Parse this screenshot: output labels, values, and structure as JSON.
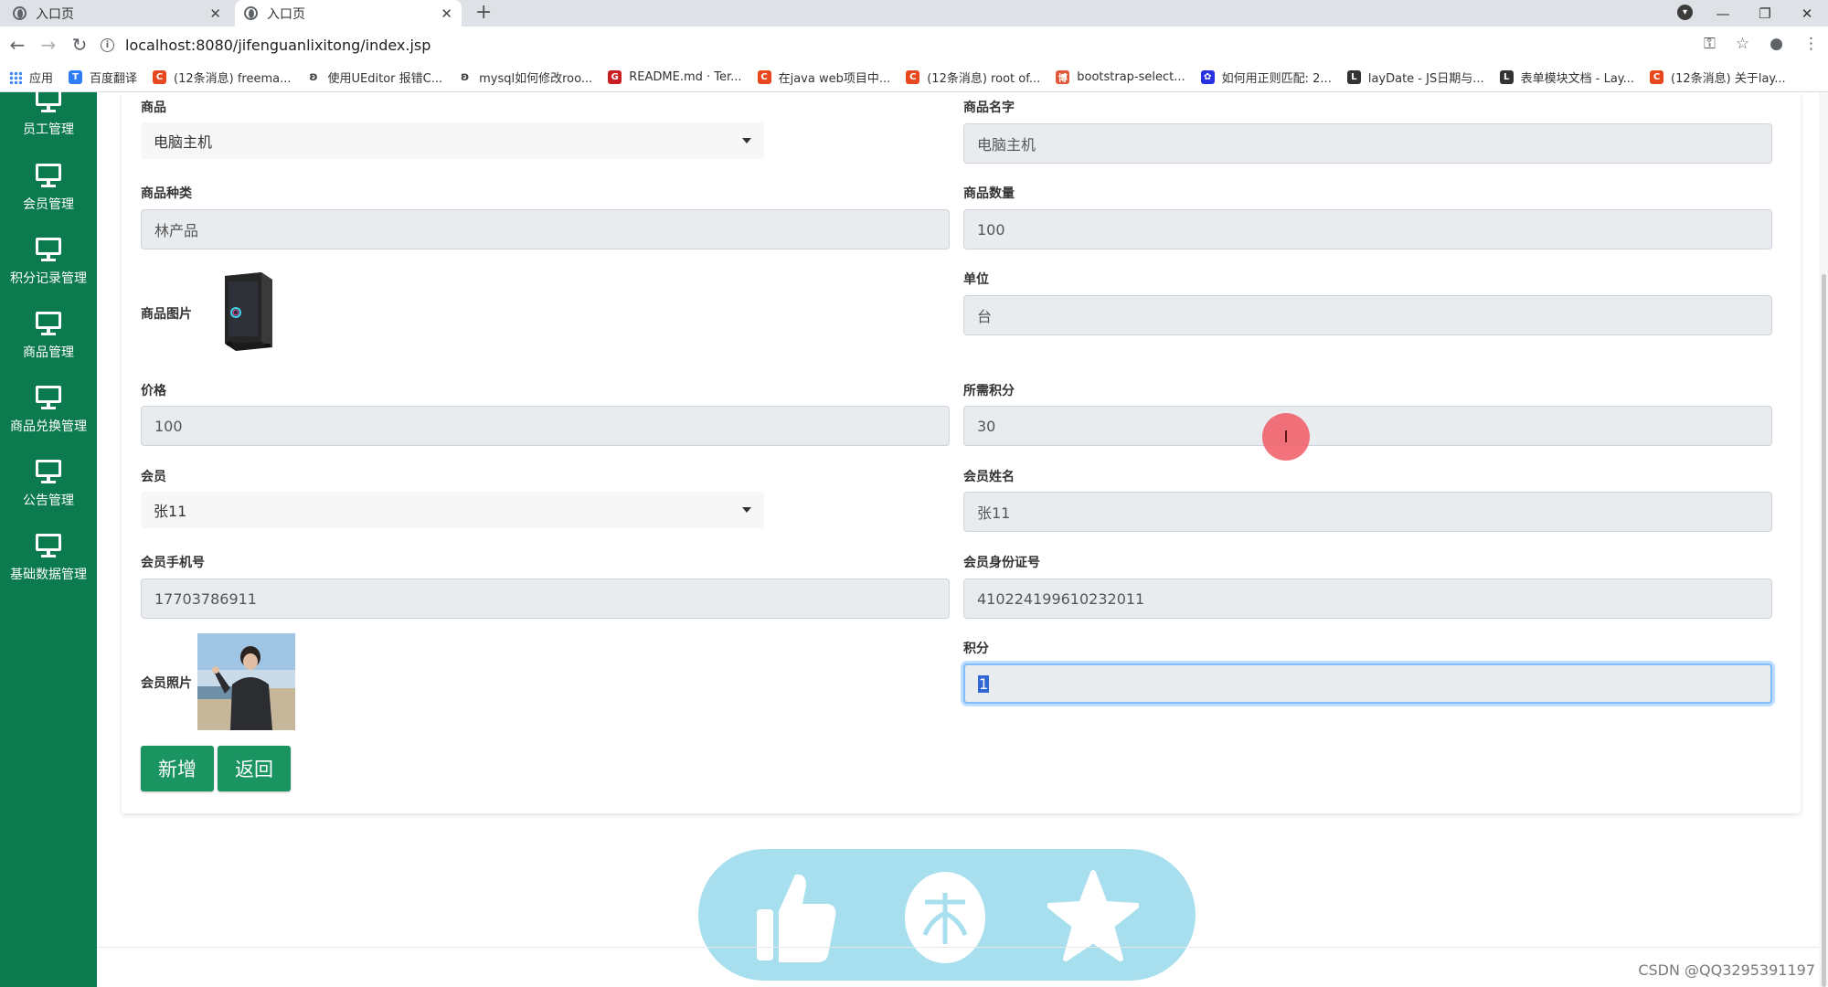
{
  "browser": {
    "tabs": [
      {
        "title": "入口页",
        "active": false
      },
      {
        "title": "入口页",
        "active": true
      }
    ],
    "url": "localhost:8080/jifenguanlixitong/index.jsp",
    "bookmarks": [
      {
        "label": "应用",
        "icon": "apps-grid-icon"
      },
      {
        "label": "百度翻译",
        "icon": "baidu-fanyi-icon",
        "color": "#2f7df6"
      },
      {
        "label": "(12条消息) freema...",
        "icon": "csdn-icon",
        "color": "#e8481e"
      },
      {
        "label": "使用UEditor 报错C...",
        "icon": "link-icon"
      },
      {
        "label": "mysql如何修改roo...",
        "icon": "link-icon"
      },
      {
        "label": "README.md · Ter...",
        "icon": "gitee-icon",
        "color": "#c71d23"
      },
      {
        "label": "在java web项目中...",
        "icon": "csdn-icon",
        "color": "#e8481e"
      },
      {
        "label": "(12条消息) root of...",
        "icon": "csdn-icon",
        "color": "#e8481e"
      },
      {
        "label": "bootstrap-select...",
        "icon": "cnblogs-icon",
        "color": "#e05a3a"
      },
      {
        "label": "如何用正则匹配: 2...",
        "icon": "baidu-paw-icon",
        "color": "#2932e1"
      },
      {
        "label": "layDate - JS日期与...",
        "icon": "layui-icon",
        "color": "#333333"
      },
      {
        "label": "表单模块文档 - Lay...",
        "icon": "layui-icon",
        "color": "#333333"
      },
      {
        "label": "(12条消息) 关于lay...",
        "icon": "csdn-icon",
        "color": "#e8481e"
      }
    ]
  },
  "sidebar": {
    "items": [
      {
        "label": "员工管理",
        "icon": "monitor-icon"
      },
      {
        "label": "会员管理",
        "icon": "monitor-icon"
      },
      {
        "label": "积分记录管理",
        "icon": "monitor-icon"
      },
      {
        "label": "商品管理",
        "icon": "monitor-icon"
      },
      {
        "label": "商品兑换管理",
        "icon": "monitor-icon"
      },
      {
        "label": "公告管理",
        "icon": "monitor-icon"
      },
      {
        "label": "基础数据管理",
        "icon": "monitor-icon"
      }
    ]
  },
  "form": {
    "goods_label": "商品",
    "goods_selected": "电脑主机",
    "goods_name_label": "商品名字",
    "goods_name": "电脑主机",
    "goods_type_label": "商品种类",
    "goods_type": "林产品",
    "goods_qty_label": "商品数量",
    "goods_qty": "100",
    "goods_image_label": "商品图片",
    "unit_label": "单位",
    "unit": "台",
    "price_label": "价格",
    "price": "100",
    "points_required_label": "所需积分",
    "points_required": "30",
    "member_label": "会员",
    "member_selected": "张11",
    "member_name_label": "会员姓名",
    "member_name": "张11",
    "member_phone_label": "会员手机号",
    "member_phone": "17703786911",
    "member_id_label": "会员身份证号",
    "member_id": "410224199610232011",
    "member_photo_label": "会员照片",
    "points_label": "积分",
    "points": "1",
    "add_button": "新增",
    "back_button": "返回"
  },
  "watermark": "CSDN @QQ3295391197",
  "colors": {
    "sidebar": "#0b7a4e",
    "button": "#1a9461",
    "likebar": "#a8dfee"
  }
}
